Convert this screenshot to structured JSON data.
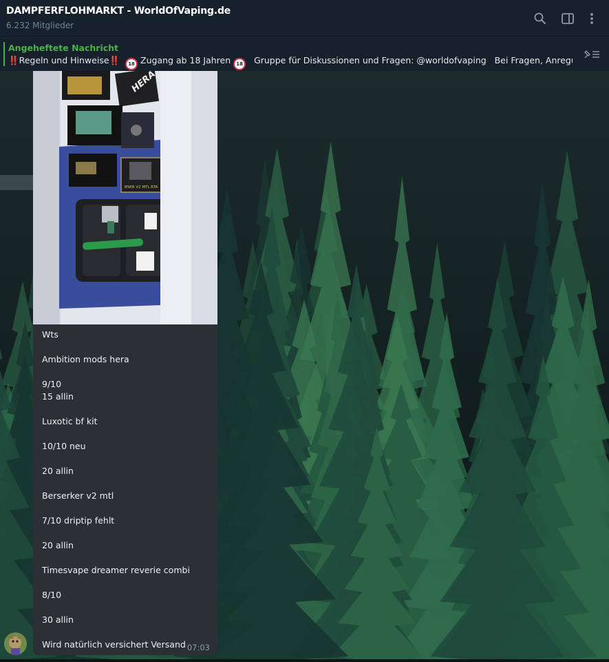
{
  "header": {
    "title": "DAMPFERFLOHMARKT - WorldOfVaping.de",
    "members": "6.232 Mitglieder",
    "icons": [
      "search-icon",
      "sidebar-toggle-icon",
      "more-vertical-icon"
    ]
  },
  "pinned": {
    "title": "Angeheftete Nachricht",
    "seg1": "Regeln und Hinweise",
    "seg2": "Zugang ab 18 Jahren",
    "seg3": "Gruppe für Diskussionen und Fragen: @worldofvaping",
    "seg4": "Bei Fragen, Anregun...",
    "exclaim": "‼️",
    "badge": "18",
    "icon": "unpin-list-icon"
  },
  "message": {
    "lines": [
      "Wts",
      "",
      "Ambition mods hera",
      "",
      "9/10",
      "15 allin",
      "",
      "Luxotic bf kit",
      "",
      "10/10 neu",
      "",
      "20 allin",
      "",
      "Berserker v2 mtl",
      "",
      "7/10 driptip fehlt",
      "",
      "20 allin",
      "",
      "Timesvape dreamer reverie combi",
      "",
      "8/10",
      "",
      "30 allin",
      "",
      "Wird natürlich versichert  Versand"
    ],
    "time": "07:03",
    "photo_labels": {
      "hera": "HERA",
      "rta": "BSKR V2 MTL RTA"
    }
  },
  "colors": {
    "header_bg": "#17212b",
    "accent_green": "#4fae4e",
    "bubble_bg": "#2b3035",
    "muted": "#708499"
  }
}
